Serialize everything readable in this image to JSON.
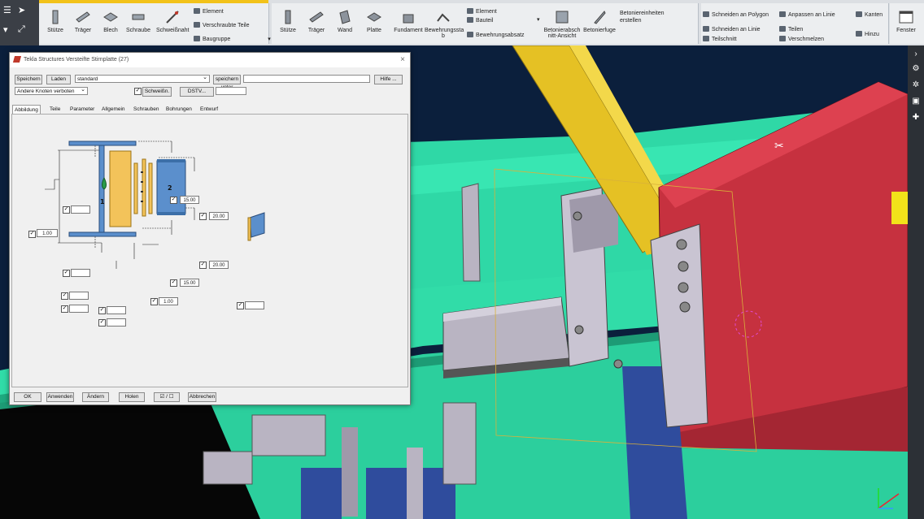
{
  "ribbon": {
    "steel_tools": [
      {
        "label": "Stütze",
        "icon": "column-icon"
      },
      {
        "label": "Träger",
        "icon": "beam-icon"
      },
      {
        "label": "Blech",
        "icon": "plate-icon"
      },
      {
        "label": "Schraube",
        "icon": "bolt-icon"
      },
      {
        "label": "Schweißnaht",
        "icon": "weld-icon"
      }
    ],
    "steel_small": [
      "Element",
      "Verschraubte Teile",
      "Baugruppe"
    ],
    "concrete_tools": [
      {
        "label": "Stütze",
        "icon": "column-icon"
      },
      {
        "label": "Träger",
        "icon": "beam-icon"
      },
      {
        "label": "Wand",
        "icon": "wall-icon"
      },
      {
        "label": "Platte",
        "icon": "slab-icon"
      },
      {
        "label": "Fundament",
        "icon": "footing-icon"
      },
      {
        "label": "Bewehrungssta b",
        "icon": "rebar-icon"
      }
    ],
    "rebar_small": [
      "Element",
      "Bauteil",
      "Bewehrungsabsatz"
    ],
    "section_view": "Betonierabsch nitt-Ansicht",
    "pour_break": "Betonierfuge",
    "pour_units": "Betoniereinheiten erstellen",
    "edit_tools": [
      "Schneiden an Polygon",
      "Schneiden an Linie",
      "Teilschnitt",
      "Anpassen an Linie",
      "Teilen",
      "Verschmelzen"
    ],
    "right_tools": [
      "Kanten",
      "Hinzu"
    ],
    "window": "Fenster"
  },
  "dialog": {
    "title": "Tekla Structures  Versteifte Stirnplatte (27)",
    "save": "Speichern",
    "load": "Laden",
    "preset": "standard",
    "save_as": "speichern unter",
    "save_as_value": "",
    "help": "Hilfe ...",
    "other_nodes": "Andere Knoten verboten",
    "weld_label": "Schweißn.",
    "dstv": "DSTV...",
    "dstv_value": "",
    "tabs": [
      "Abbildung",
      "Teile",
      "Parameter",
      "Allgemein",
      "Schrauben",
      "Bohrungen",
      "Entwurf"
    ],
    "dims": {
      "left_factor": "1.00",
      "top_15": "15.00",
      "top_20": "20.00",
      "bottom_20": "20.00",
      "bottom_15": "15.00",
      "bottom_factor": "1.00"
    },
    "part_labels": [
      "1",
      "2"
    ],
    "footer": [
      "OK",
      "Anwenden",
      "Ändern",
      "Holen",
      "☑ / ☐",
      "Abbrechen"
    ]
  },
  "colors": {
    "sky": "#0b1f3c",
    "concrete_green": "#2fd8a6",
    "red_beam": "#c6313f",
    "yellow_beam": "#e5c124",
    "blue_column": "#2f4c9d",
    "gray_plate": "#b9b4c2"
  }
}
